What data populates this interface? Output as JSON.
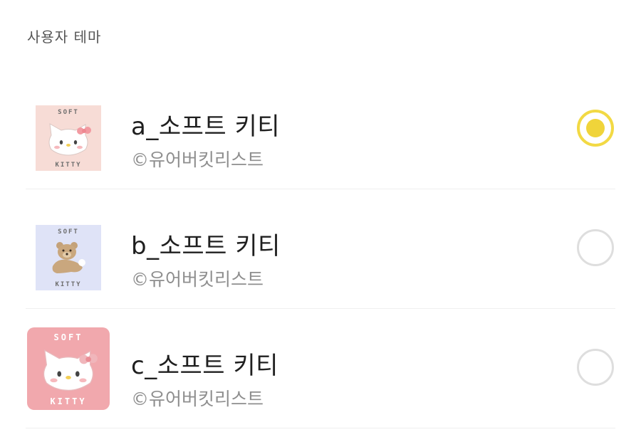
{
  "section": {
    "title": "사용자 테마"
  },
  "themes": [
    {
      "name": "a_소프트 키티",
      "credit": "©유어버킷리스트",
      "selected": true,
      "thumbnail": {
        "top_text": "SOFT",
        "bottom_text": "KITTY",
        "background": "#f7dcd6",
        "icon": "kitty-face-icon"
      }
    },
    {
      "name": "b_소프트 키티",
      "credit": "©유어버킷리스트",
      "selected": false,
      "thumbnail": {
        "top_text": "SOFT",
        "bottom_text": "KITTY",
        "background": "#dfe3f7",
        "icon": "bear-plush-icon"
      }
    },
    {
      "name": "c_소프트 키티",
      "credit": "©유어버킷리스트",
      "selected": false,
      "thumbnail": {
        "top_text": "SOFT",
        "bottom_text": "KITTY",
        "background": "#f1a8ad",
        "icon": "kitty-face-icon"
      }
    }
  ],
  "colors": {
    "accent_selected": "#f0d43a",
    "radio_border": "#dedede",
    "credit_text": "#8e8e8e",
    "divider": "#efefef"
  }
}
